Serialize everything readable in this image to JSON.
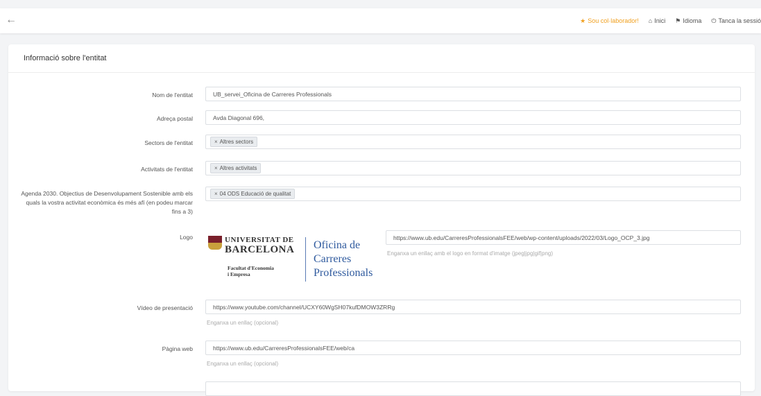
{
  "topbar": {
    "back_icon": "arrow-left-icon",
    "collab_label": "Sou col·laborador!",
    "home_label": "Inici",
    "language_label": "Idioma",
    "logout_label": "Tanca la sessió",
    "collab_color": "#f0a020"
  },
  "card": {
    "title": "Informació sobre l'entitat"
  },
  "form": {
    "name_label": "Nom de l'entitat",
    "name_value": "UB_servei_Oficina de Carreres Professionals",
    "address_label": "Adreça postal",
    "address_value": "Avda Diagonal 696,",
    "sectors_label": "Sectors de l'entitat",
    "sectors_tag": "Altres sectors",
    "activities_label": "Activitats de l'entitat",
    "activities_tag": "Altres activitats",
    "agenda_label": "Agenda 2030. Objectius de Desenvolupament Sostenible amb els quals la vostra activitat econòmica és més afí (en podeu marcar fins a 3)",
    "agenda_tag": "04 ODS Educació de qualitat",
    "logo_label": "Logo",
    "logo_url": "https://www.ub.edu/CarreresProfessionalsFEE/web/wp-content/uploads/2022/03/Logo_OCP_3.jpg",
    "logo_help": "Enganxa un enllaç amb el logo en format d'imatge (jpeg|jpg|gif|png)",
    "video_label": "Vídeo de presentació",
    "video_value": "https://www.youtube.com/channel/UCXY60WgSH07kufDMOW3ZRRg",
    "video_help": "Enganxa un enllaç (opcional)",
    "web_label": "Pàgina web",
    "web_value": "https://www.ub.edu/CarreresProfessionalsFEE/web/ca",
    "web_help": "Enganxa un enllaç (opcional)"
  },
  "logo_image": {
    "university": "UNIVERSITAT DE",
    "city": "BARCELONA",
    "faculty_line1": "Facultat d'Economia",
    "faculty_line2": "i Empresa",
    "office_line1": "Oficina de",
    "office_line2": "Carreres",
    "office_line3": "Professionals"
  }
}
